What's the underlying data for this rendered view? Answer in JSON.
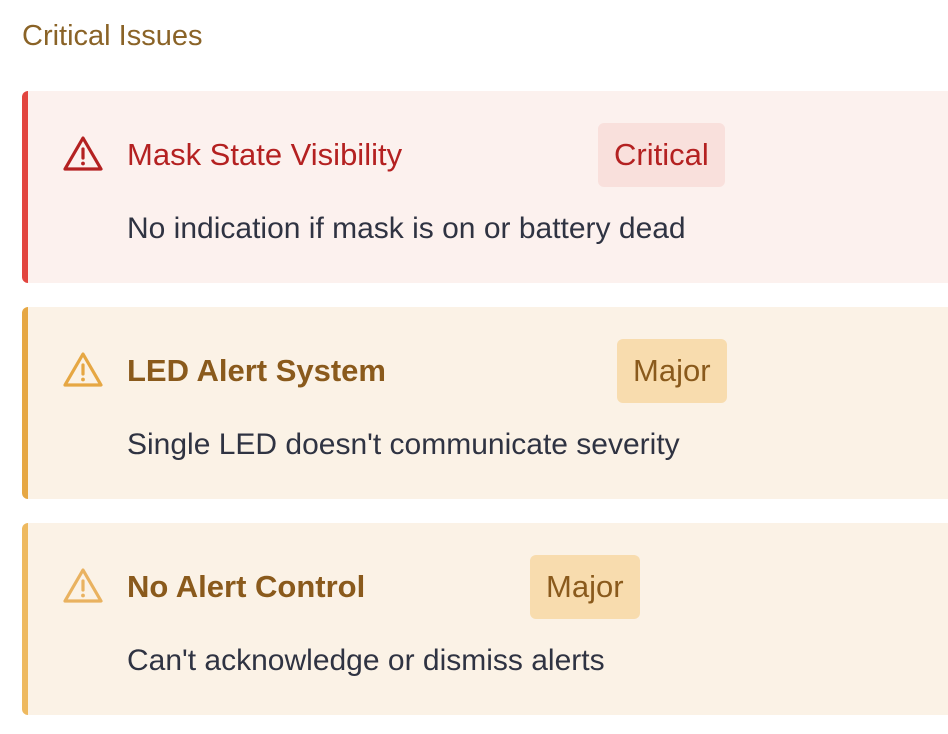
{
  "section": {
    "title": "Critical Issues"
  },
  "issues": [
    {
      "title": "Mask State Visibility",
      "severity": "Critical",
      "description": "No indication if mask is on or battery dead",
      "icon": "warning-triangle-icon",
      "accent_color": "#e2453f"
    },
    {
      "title": "LED Alert System",
      "severity": "Major",
      "description": "Single LED doesn't communicate severity",
      "icon": "warning-triangle-icon",
      "accent_color": "#e6a743"
    },
    {
      "title": "No Alert Control",
      "severity": "Major",
      "description": "Can't acknowledge or dismiss alerts",
      "icon": "warning-triangle-icon",
      "accent_color": "#eeb95f"
    }
  ]
}
